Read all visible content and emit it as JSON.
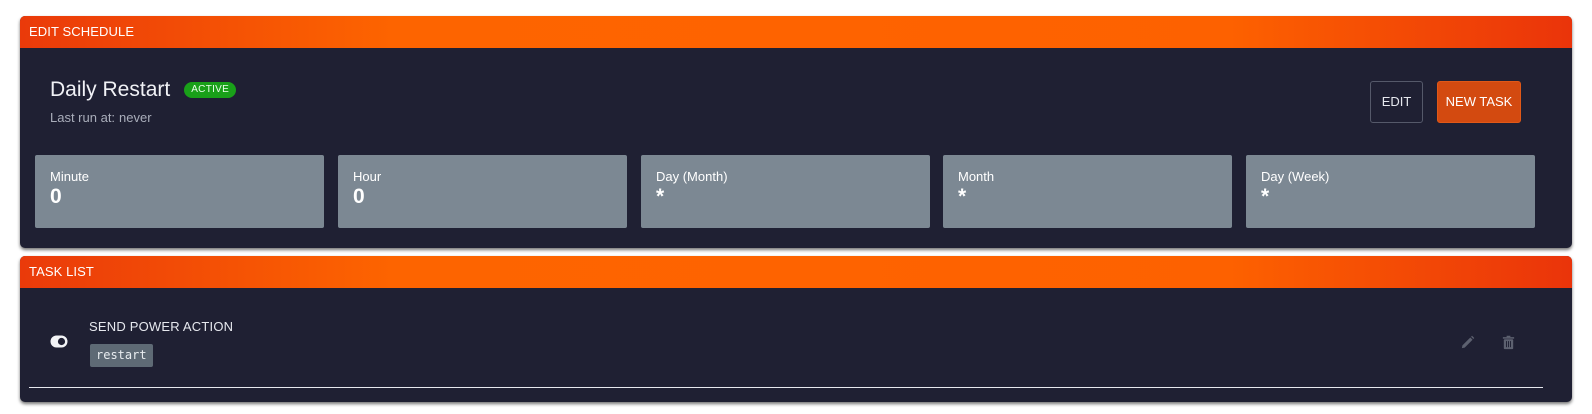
{
  "schedule_panel": {
    "header": "EDIT SCHEDULE",
    "title": "Daily Restart",
    "status_badge": "ACTIVE",
    "last_run_label": "Last run at:",
    "last_run_value": "never",
    "buttons": {
      "edit": "EDIT",
      "new_task": "NEW TASK"
    },
    "cron": [
      {
        "label": "Minute",
        "value": "0"
      },
      {
        "label": "Hour",
        "value": "0"
      },
      {
        "label": "Day (Month)",
        "value": "*"
      },
      {
        "label": "Month",
        "value": "*"
      },
      {
        "label": "Day (Week)",
        "value": "*"
      }
    ]
  },
  "task_panel": {
    "header": "TASK LIST",
    "tasks": [
      {
        "title": "SEND POWER ACTION",
        "payload": "restart",
        "icons": {
          "toggle": "toggle-icon",
          "edit": "pencil-icon",
          "delete": "trash-icon"
        }
      }
    ]
  },
  "colors": {
    "header_gradient_start": "#ea3a0a",
    "header_gradient_mid": "#fe6300",
    "panel_bg": "#1f2033",
    "badge_active": "#19a019",
    "new_task_button": "#d34a10",
    "cron_box": "#7c8893"
  }
}
